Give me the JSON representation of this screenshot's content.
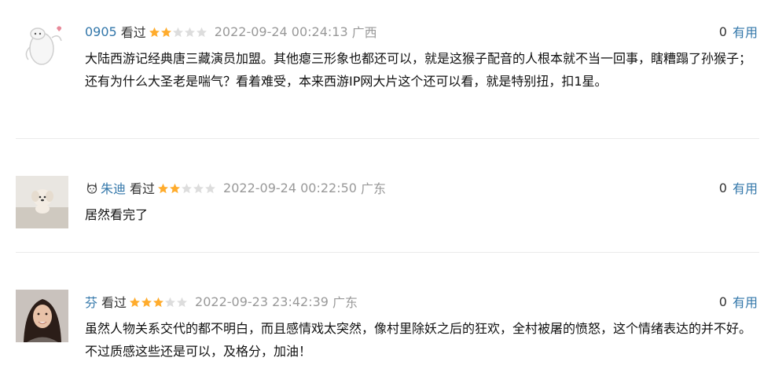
{
  "comments": [
    {
      "user": "0905",
      "status": "看过",
      "rating": 2,
      "time": "2022-09-24 00:24:13",
      "location": "广西",
      "votes": "0",
      "useful_label": "有用",
      "text": "大陆西游记经典唐三藏演员加盟。其他瘪三形象也都还可以，就是这猴子配音的人根本就不当一回事，瞎糟蹋了孙猴子；还有为什么大圣老是喘气？看着难受，本来西游IP网大片这个还可以看，就是特别扭，扣1星。"
    },
    {
      "user": "朱迪",
      "status": "看过",
      "rating": 2,
      "time": "2022-09-24 00:22:50",
      "location": "广东",
      "votes": "0",
      "useful_label": "有用",
      "text": "居然看完了"
    },
    {
      "user": "芬",
      "status": "看过",
      "rating": 3,
      "time": "2022-09-23 23:42:39",
      "location": "广东",
      "votes": "0",
      "useful_label": "有用",
      "text": "虽然人物关系交代的都不明白，而且感情戏太突然，像村里除妖之后的狂欢，全村被屠的愤怒，这个情绪表达的并不好。不过质感这些还是可以，及格分，加油！"
    }
  ],
  "colors": {
    "link": "#3377aa",
    "star_on": "#ffac2d",
    "star_off": "#dddddd",
    "meta": "#999999"
  },
  "icons": {
    "star": "star-icon",
    "badge": "rabbit-badge-icon"
  }
}
